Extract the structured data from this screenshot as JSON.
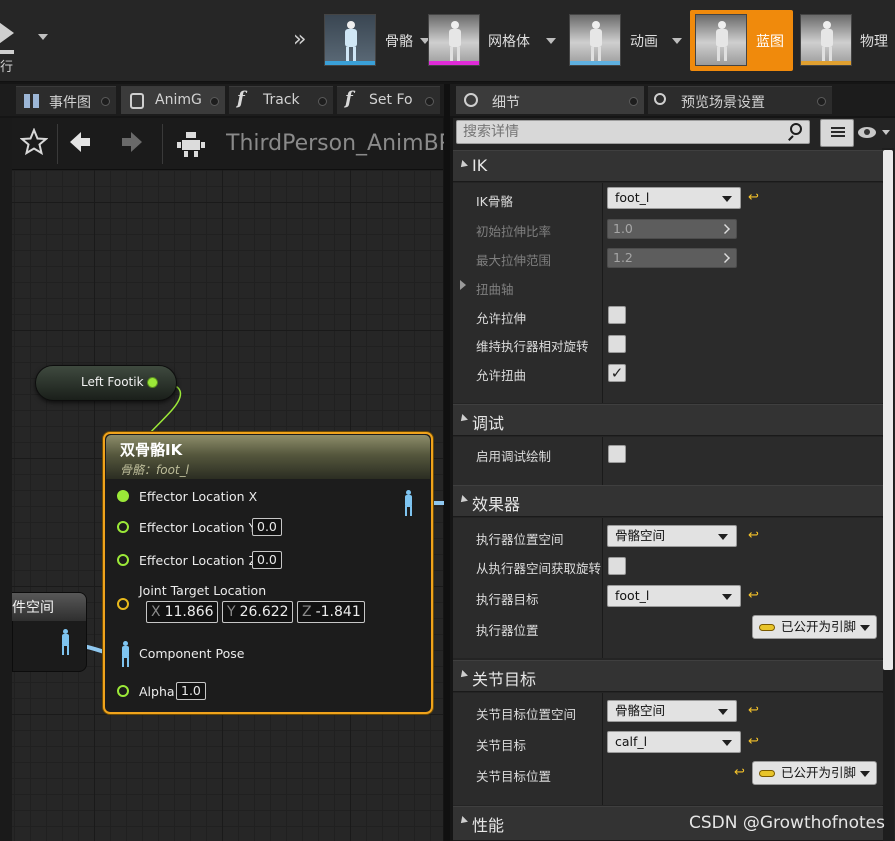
{
  "toolbar": {
    "play_label": "行",
    "modes": [
      {
        "label": "骨骼",
        "icon": "skeleton-icon"
      },
      {
        "label": "网格体",
        "icon": "mesh-icon"
      },
      {
        "label": "动画",
        "icon": "animation-icon"
      },
      {
        "label": "蓝图",
        "icon": "blueprint-icon"
      },
      {
        "label": "物理",
        "icon": "physics-icon"
      }
    ],
    "active_mode_color": "#f08a0c"
  },
  "left_tabs": [
    {
      "label": "事件图",
      "icon": "event-graph-icon"
    },
    {
      "label": "AnimG",
      "icon": "anim-graph-icon"
    },
    {
      "label": "Track",
      "icon": "function-icon"
    },
    {
      "label": "Set Fo",
      "icon": "function-icon"
    }
  ],
  "right_tabs": [
    {
      "label": "细节",
      "icon": "details-icon"
    },
    {
      "label": "预览场景设置",
      "icon": "preview-scene-icon"
    }
  ],
  "graph": {
    "breadcrumb_title": "ThirdPerson_AnimBP",
    "footik_node": {
      "label": "Left Footik"
    },
    "ik_node": {
      "title": "双骨骼IK",
      "subtitle": "骨骼：foot_l",
      "pins": [
        {
          "label": "Effector Location X",
          "value": ""
        },
        {
          "label": "Effector Location Y",
          "value": "0.0"
        },
        {
          "label": "Effector Location Z",
          "value": "0.0"
        },
        {
          "label": "Joint Target Location",
          "value": ""
        },
        {
          "label": "Component Pose",
          "value": ""
        },
        {
          "label": "Alpha",
          "value": "1.0"
        }
      ],
      "joint_target": {
        "x_label": "X",
        "x": "11.866",
        "y_label": "Y",
        "y": "26.622",
        "z_label": "Z",
        "z": "-1.841"
      }
    },
    "space_node": {
      "title": "件空间"
    }
  },
  "details": {
    "search_placeholder": "搜索详情",
    "ik": {
      "header": "IK",
      "ik_bone_label": "IK骨骼",
      "ik_bone_value": "foot_l",
      "start_stretch_label": "初始拉伸比率",
      "start_stretch_value": "1.0",
      "max_stretch_label": "最大拉伸范围",
      "max_stretch_value": "1.2",
      "twist_axis_label": "扭曲轴",
      "allow_stretch_label": "允许拉伸",
      "allow_stretch": false,
      "maintain_rotation_label": "维持执行器相对旋转",
      "maintain_rotation": false,
      "allow_twist_label": "允许扭曲",
      "allow_twist": true
    },
    "debug": {
      "header": "调试",
      "enable_debug_label": "启用调试绘制",
      "enable_debug": false
    },
    "effector": {
      "header": "效果器",
      "location_space_label": "执行器位置空间",
      "location_space_value": "骨骼空间",
      "take_rotation_label": "从执行器空间获取旋转",
      "take_rotation": false,
      "target_label": "执行器目标",
      "target_value": "foot_l",
      "location_label": "执行器位置",
      "location_value": "已公开为引脚"
    },
    "joint_target": {
      "header": "关节目标",
      "space_label": "关节目标位置空间",
      "space_value": "骨骼空间",
      "target_label": "关节目标",
      "target_value": "calf_l",
      "location_label": "关节目标位置",
      "location_value": "已公开为引脚"
    },
    "performance": {
      "header": "性能"
    }
  },
  "watermark": "CSDN @Growthofnotes"
}
